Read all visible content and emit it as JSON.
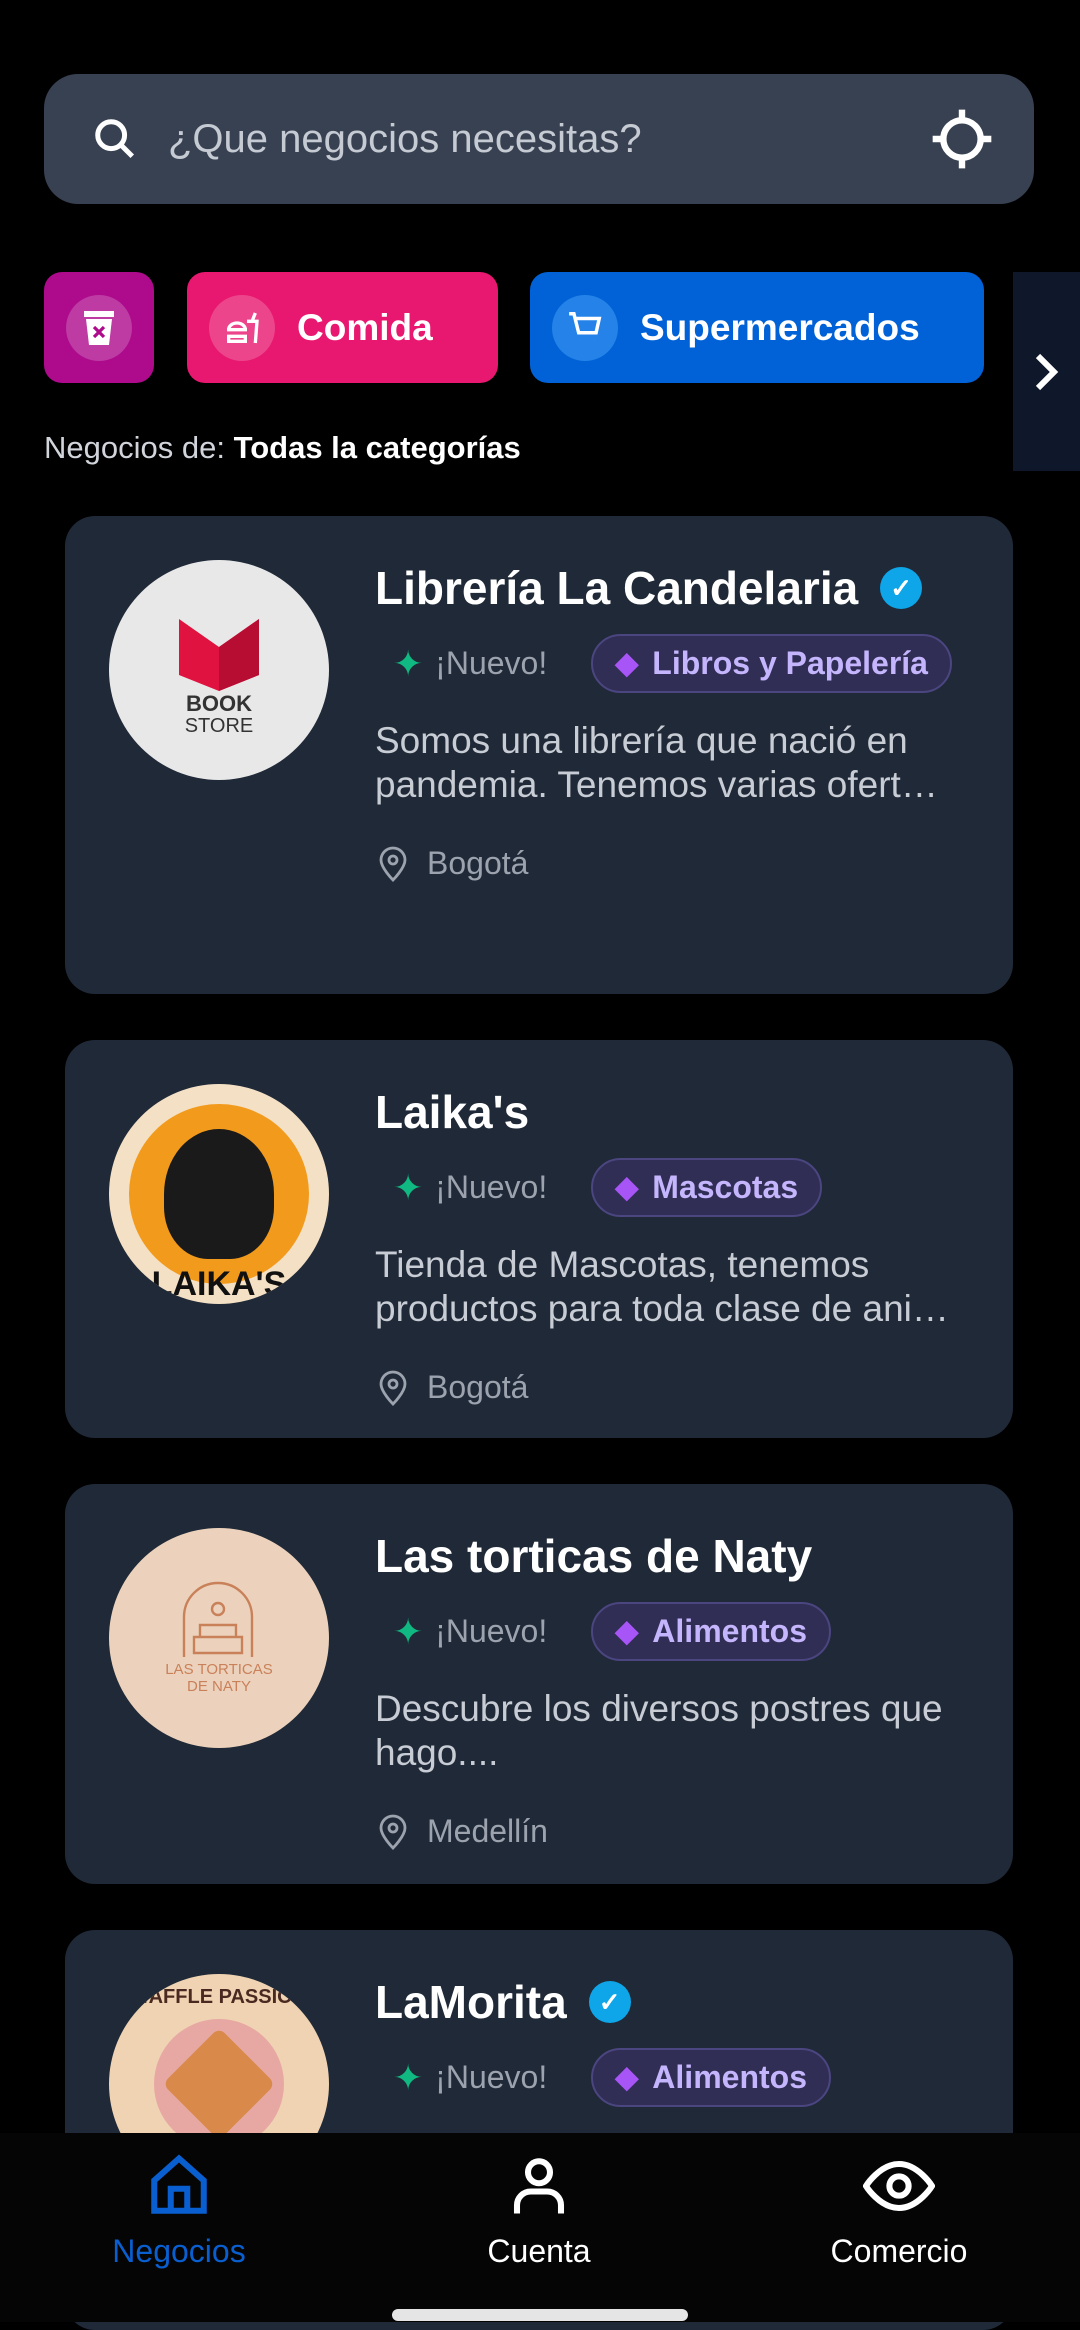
{
  "search": {
    "placeholder": "¿Que negocios necesitas?"
  },
  "categories": [
    {
      "label": "",
      "icon": "clear-filter-icon",
      "color": "#ad0a8c"
    },
    {
      "label": "Comida",
      "icon": "fast-food-icon",
      "color": "#e8176f"
    },
    {
      "label": "Supermercados",
      "icon": "cart-icon",
      "color": "#0062d6"
    }
  ],
  "filter": {
    "prefix": "Negocios de:",
    "value": "Todas la categorías"
  },
  "businesses": [
    {
      "name": "Librería La Candelaria",
      "verified": true,
      "badge": "¡Nuevo!",
      "category": "Libros y Papelería",
      "description": "Somos una librería que nació en pandemia. Tenemos varias ofert…",
      "city": "Bogotá",
      "logo_text": [
        "BOOK",
        "STORE"
      ]
    },
    {
      "name": "Laika's",
      "verified": false,
      "badge": "¡Nuevo!",
      "category": "Mascotas",
      "description": "Tienda de Mascotas, tenemos productos para toda clase de ani…",
      "city": "Bogotá",
      "logo_text": [
        "LAIKA'S"
      ]
    },
    {
      "name": "Las torticas de Naty",
      "verified": false,
      "badge": "¡Nuevo!",
      "category": "Alimentos",
      "description": "Descubre los diversos postres que hago....",
      "city": "Medellín",
      "logo_text": [
        "LAS TORTICAS",
        "DE NATY"
      ]
    },
    {
      "name": "LaMorita",
      "verified": true,
      "badge": "¡Nuevo!",
      "category": "Alimentos",
      "logo_text": [
        "WAFFLE PASSION"
      ]
    }
  ],
  "nav": [
    {
      "label": "Negocios",
      "active": true
    },
    {
      "label": "Cuenta"
    },
    {
      "label": "Comercio"
    }
  ]
}
